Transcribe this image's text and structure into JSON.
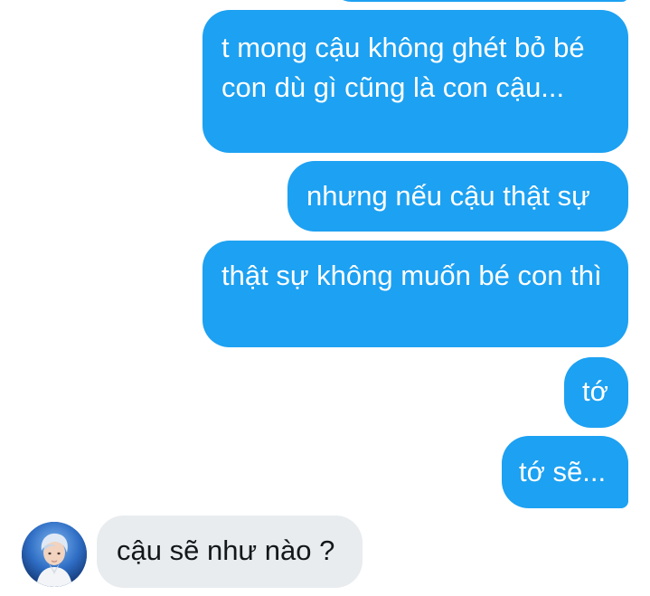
{
  "conversation": {
    "messages": [
      {
        "sender": "me",
        "text": "t mong cậu không ghét bỏ bé con dù gì cũng là con cậu..."
      },
      {
        "sender": "me",
        "text": "nhưng nếu cậu thật sự"
      },
      {
        "sender": "me",
        "text": "thật sự không muốn bé con thì"
      },
      {
        "sender": "me",
        "text": "tớ"
      },
      {
        "sender": "me",
        "text": "tớ sẽ..."
      },
      {
        "sender": "them",
        "text": "cậu sẽ như nào ?"
      }
    ]
  },
  "colors": {
    "outgoing_bubble": "#1da1f2",
    "incoming_bubble": "#e8ecef",
    "outgoing_text": "#ffffff",
    "incoming_text": "#14171a"
  },
  "icons": {
    "contact_avatar": "avatar-photo"
  }
}
